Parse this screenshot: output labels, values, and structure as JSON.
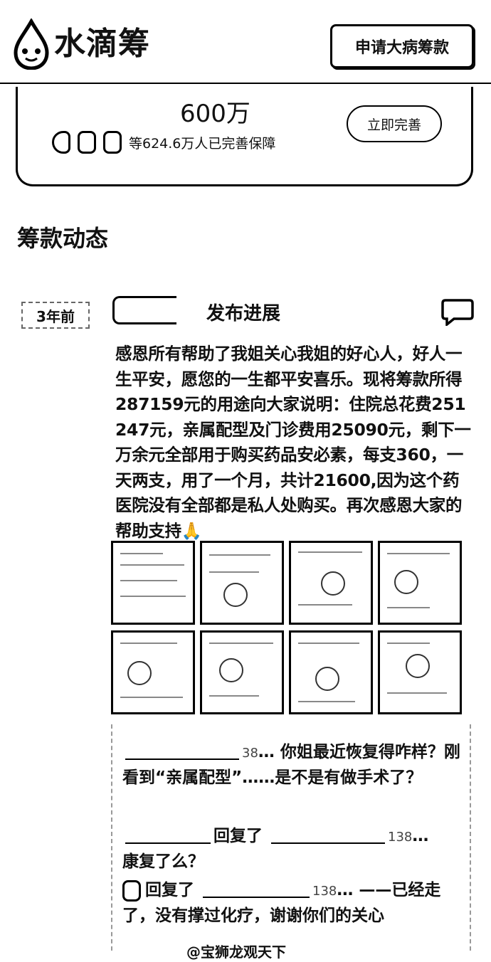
{
  "header": {
    "logo_text": "水滴筹",
    "apply_button": "申请大病筹款"
  },
  "insurance": {
    "amount": "600万",
    "people_text": "等624.6万人已完善保障",
    "button": "立即完善"
  },
  "section": {
    "title": "筹款动态"
  },
  "post": {
    "time": "3年前",
    "action": "发布进展",
    "text": "感恩所有帮助了我姐关心我姐的好心人，好人一生平安，愿您的一生都平安喜乐。现将筹款所得287159元的用途向大家说明：住院总花费251247元，亲属配型及门诊费用25090元，剩下一万余元全部用于购买药品安必素，每支360，一天两支，用了一个月，共计21600,因为这个药医院没有全部都是私人处购买。再次感恩大家的帮助支持🙏",
    "photo_count": 8
  },
  "comments": [
    {
      "author_suffix": "38",
      "text": "你姐最近恢复得咋样？刚看到“亲属配型”……是不是有做手术了？"
    },
    {
      "reply_word": "回复了",
      "target_suffix": "138",
      "text": "康复了么？"
    },
    {
      "reply_word": "回复了",
      "target_suffix": "138",
      "text": "——已经走了，没有撑过化疗，谢谢你们的关心"
    }
  ],
  "watermark": "@宝狮龙观天下"
}
